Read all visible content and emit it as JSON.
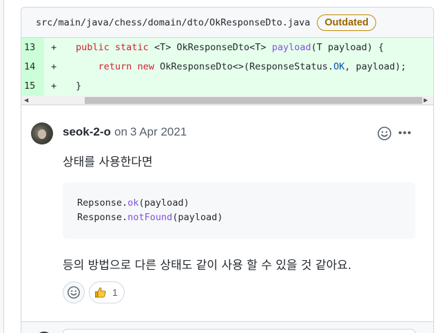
{
  "file": {
    "path": "src/main/java/chess/domain/dto/OkResponseDto.java",
    "badge": "Outdated"
  },
  "code_lines": [
    {
      "number": "13",
      "sign": "+"
    },
    {
      "number": "14",
      "sign": "+"
    },
    {
      "number": "15",
      "sign": "+"
    }
  ],
  "code_tokens": {
    "public": "public",
    "static": "static",
    "generic": "<T>",
    "return_type": "OkResponseDto<T>",
    "method": "payload",
    "params": "(T payload) {",
    "return_kw": "return",
    "new_kw": "new",
    "ctor": "OkResponseDto<>(ResponseStatus.",
    "ok_const": "OK",
    "ctor_tail": ", payload);",
    "close_brace": "}"
  },
  "comment": {
    "author": "seok-2-o",
    "on": "on",
    "date": "3 Apr 2021",
    "body_line1": "상태를 사용한다면",
    "snippet": {
      "line1_prefix": "Repsonse.",
      "line1_method": "ok",
      "line1_suffix": "(payload)",
      "line2_prefix": "Response.",
      "line2_method": "notFound",
      "line2_suffix": "(payload)"
    },
    "body_line2": "등의 방법으로 다른 상태도 같이 사용 할 수 있을 것 같아요.",
    "reaction": {
      "icon": "thumbs-up-icon",
      "count": "1"
    }
  },
  "colors": {
    "added_line_bg": "#e6ffec",
    "line_number_bg": "#ccffd8",
    "keyword": "#cf222e",
    "function": "#8250df",
    "constant": "#0550ae",
    "badge_border": "#bf8700"
  }
}
